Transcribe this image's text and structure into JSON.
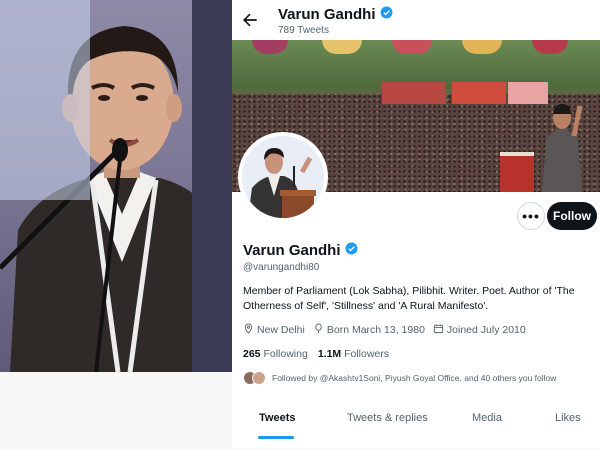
{
  "colors": {
    "accent": "#1d9bf0",
    "text": "#0f1419",
    "muted": "#536471",
    "follow_bg": "#0f1419"
  },
  "header": {
    "name": "Varun Gandhi",
    "tweet_count": "789 Tweets",
    "back_icon": "arrow-left-icon",
    "verified_icon": "verified-badge-icon"
  },
  "actions": {
    "more_label": "•••",
    "follow_label": "Follow"
  },
  "profile": {
    "name": "Varun Gandhi",
    "handle": "@varungandhi80",
    "bio": "Member of Parliament (Lok Sabha), Pilibhit. Writer. Poet. Author of 'The Otherness of Self', 'Stillness' and 'A Rural Manifesto'.",
    "location": "New Delhi",
    "born": "Born March 13, 1980",
    "joined": "Joined July 2010",
    "following_count": "265",
    "following_label": "Following",
    "followers_count": "1.1M",
    "followers_label": "Followers",
    "followed_by": "Followed by @Akashtv1Soni, Piyush Goyal Office, and 40 others you follow"
  },
  "tabs": [
    {
      "label": "Tweets",
      "active": true
    },
    {
      "label": "Tweets & replies",
      "active": false
    },
    {
      "label": "Media",
      "active": false
    },
    {
      "label": "Likes",
      "active": false
    }
  ]
}
